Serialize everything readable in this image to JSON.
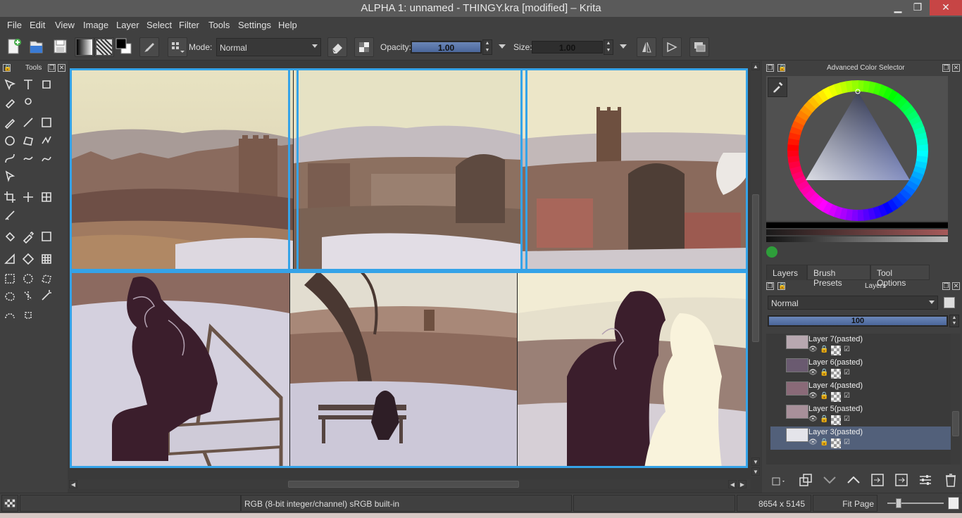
{
  "window": {
    "title": "ALPHA 1: unnamed - THINGY.kra [modified] – Krita",
    "minimize_glyph": "▁",
    "maximize_glyph": "❐",
    "close_glyph": "✕"
  },
  "menu": [
    "File",
    "Edit",
    "View",
    "Image",
    "Layer",
    "Select",
    "Filter",
    "Tools",
    "Settings",
    "Help"
  ],
  "toolbar": {
    "mode_label": "Mode:",
    "mode_value": "Normal",
    "opacity_label": "Opacity:",
    "opacity_value": "1.00",
    "opacity_fraction": 1.0,
    "size_label": "Size:",
    "size_value": "1.00",
    "size_fraction": 0.02
  },
  "tools_panel": {
    "title": "Tools",
    "tools": [
      "move-icon",
      "text-icon",
      "transform-perspective-icon",
      "calligraphy-icon",
      "multibrush-icon",
      "brush-icon",
      "line-icon",
      "rectangle-icon",
      "ellipse-icon",
      "polygon-icon",
      "polyline-icon",
      "bezier-icon",
      "freehand-path-icon",
      "dynamic-brush-icon",
      "shape-select-icon",
      "crop-icon",
      "move-layer-icon",
      "transform-icon",
      "measure-icon",
      "fill-icon",
      "color-picker-icon",
      "gradient-icon",
      "assistant-icon",
      "perspective-grid-icon",
      "grid-icon",
      "rect-select-icon",
      "ellipse-select-icon",
      "polygon-select-icon",
      "freehand-select-icon",
      "contiguous-select-icon",
      "magic-wand-icon",
      "bezier-select-icon",
      "similar-select-icon"
    ]
  },
  "color_selector": {
    "title": "Advanced Color Selector",
    "hue": "#2a3d96"
  },
  "dock_tabs": [
    "Layers",
    "Brush Presets",
    "Tool Options"
  ],
  "layers_panel": {
    "title": "Layers",
    "blend_mode": "Normal",
    "opacity_value": "100",
    "opacity_fraction": 1.0,
    "layers": [
      {
        "name": "Layer 7(pasted)",
        "active": false
      },
      {
        "name": "Layer 6(pasted)",
        "active": false
      },
      {
        "name": "Layer 4(pasted)",
        "active": false
      },
      {
        "name": "Layer 5(pasted)",
        "active": false
      },
      {
        "name": "Layer 3(pasted)",
        "active": true
      }
    ]
  },
  "status": {
    "colorspace": "RGB (8-bit integer/channel)  sRGB built-in",
    "dimensions": "8654 x 5145",
    "zoom": "Fit Page"
  }
}
